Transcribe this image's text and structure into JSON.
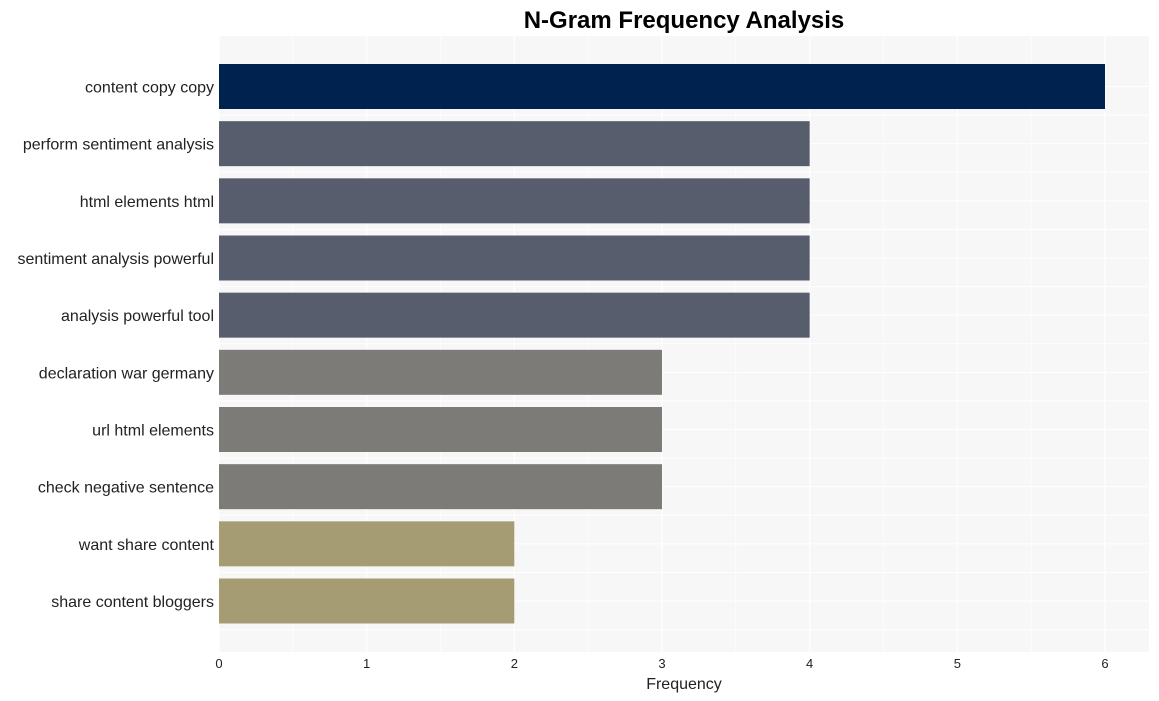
{
  "chart_data": {
    "type": "bar",
    "orientation": "horizontal",
    "title": "N-Gram Frequency Analysis",
    "xlabel": "Frequency",
    "ylabel": "",
    "xlim": [
      0,
      6.3
    ],
    "xticks": [
      0,
      1,
      2,
      3,
      4,
      5,
      6
    ],
    "grid": true,
    "legend": "none",
    "categories": [
      "content copy copy",
      "perform sentiment analysis",
      "html elements html",
      "sentiment analysis powerful",
      "analysis powerful tool",
      "declaration war germany",
      "url html elements",
      "check negative sentence",
      "want share content",
      "share content bloggers"
    ],
    "values": [
      6,
      4,
      4,
      4,
      4,
      3,
      3,
      3,
      2,
      2
    ],
    "colors": [
      "#00224e",
      "#575d6d",
      "#575d6d",
      "#575d6d",
      "#575d6d",
      "#7c7b78",
      "#7c7b78",
      "#7c7b78",
      "#a59c74",
      "#a59c74"
    ],
    "plot_background": "#f7f7f7",
    "grid_color": "#ffffff"
  }
}
